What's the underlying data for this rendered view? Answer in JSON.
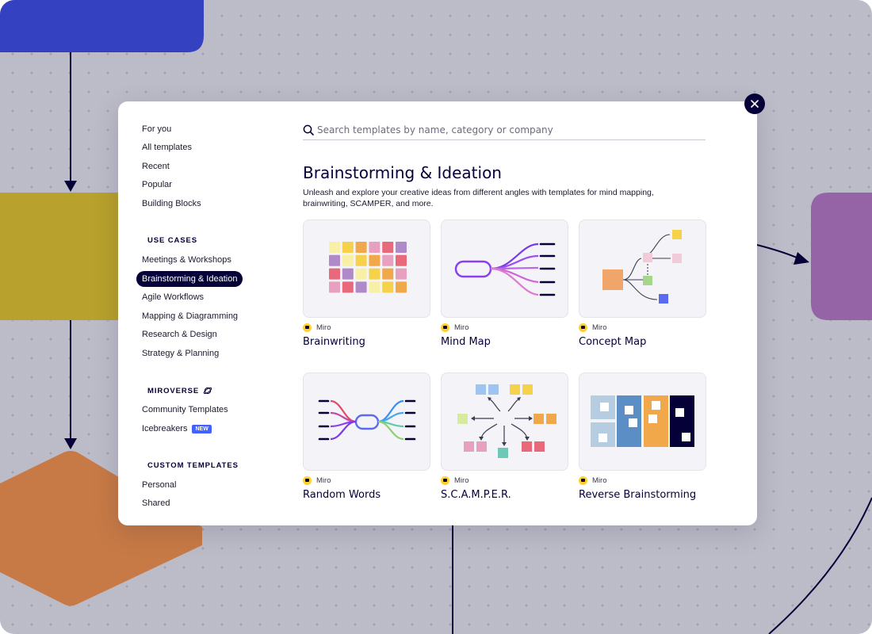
{
  "close_icon": "close-icon",
  "sidebar": {
    "main_items": [
      {
        "label": "For you"
      },
      {
        "label": "All templates"
      },
      {
        "label": "Recent"
      },
      {
        "label": "Popular"
      },
      {
        "label": "Building Blocks"
      }
    ],
    "use_cases": {
      "title": "USE CASES",
      "items": [
        {
          "label": "Meetings & Workshops"
        },
        {
          "label": "Brainstorming & Ideation",
          "active": true
        },
        {
          "label": "Agile Workflows"
        },
        {
          "label": "Mapping & Diagramming"
        },
        {
          "label": "Research & Design"
        },
        {
          "label": "Strategy & Planning"
        }
      ]
    },
    "miroverse": {
      "title": "MIROVERSE",
      "icon": "planet-icon",
      "items": [
        {
          "label": "Community Templates"
        },
        {
          "label": "Icebreakers",
          "badge": "NEW"
        }
      ]
    },
    "custom_templates": {
      "title": "CUSTOM TEMPLATES",
      "items": [
        {
          "label": "Personal"
        },
        {
          "label": "Shared"
        }
      ]
    }
  },
  "search": {
    "placeholder": "Search templates by name, category or company",
    "icon": "search-icon"
  },
  "main": {
    "title": "Brainstorming & Ideation",
    "description": "Unleash and explore your creative ideas from different angles with templates for mind mapping, brainwriting, SCAMPER, and more.",
    "templates": [
      {
        "name": "Brainwriting",
        "author": "Miro"
      },
      {
        "name": "Mind Map",
        "author": "Miro"
      },
      {
        "name": "Concept Map",
        "author": "Miro"
      },
      {
        "name": "Random Words",
        "author": "Miro"
      },
      {
        "name": "S.C.A.M.P.E.R.",
        "author": "Miro"
      },
      {
        "name": "Reverse Brainstorming",
        "author": "Miro"
      }
    ]
  },
  "colors": {
    "brand_dark": "#050038",
    "active_pill": "#050038",
    "new_badge": "#4262ff",
    "miro_yellow": "#ffd02f"
  }
}
